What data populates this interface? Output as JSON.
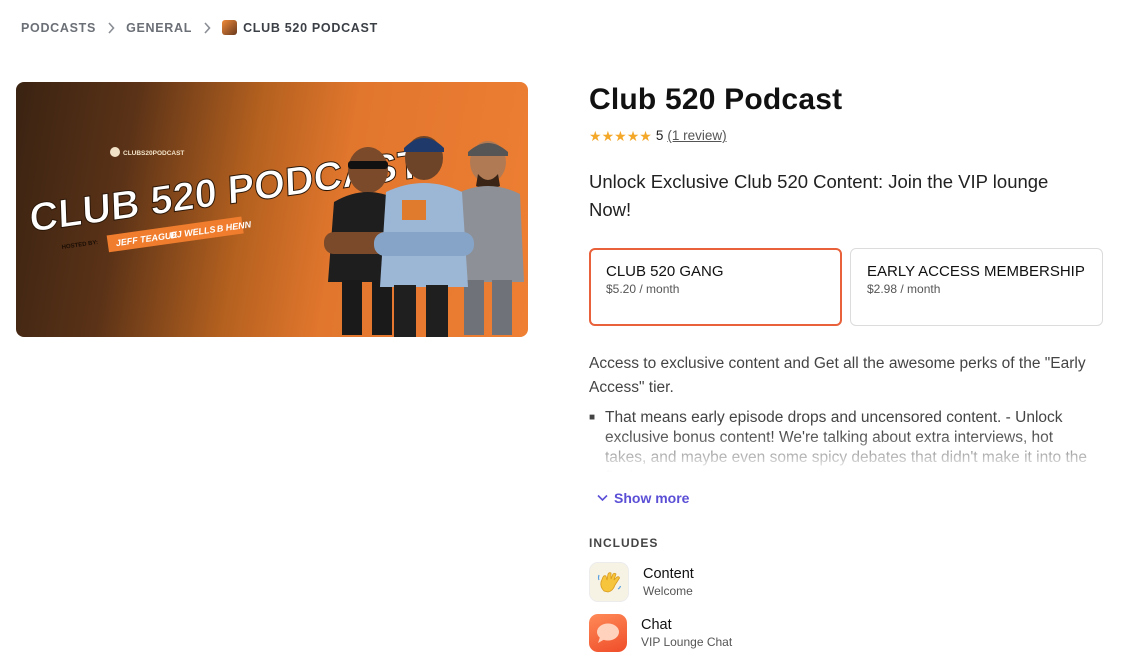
{
  "breadcrumb": {
    "items": [
      "PODCASTS",
      "GENERAL",
      "CLUB 520 PODCAST"
    ]
  },
  "banner": {
    "small_logo_text": "CLUBS20PODCAST",
    "title_line": "CLUB 520 PODCAST",
    "hosted_by": "HOSTED BY:",
    "hosts": [
      "JEFF TEAGUE",
      "DJ WELLS",
      "B HENN"
    ]
  },
  "product": {
    "title": "Club 520 Podcast",
    "rating_value": "5",
    "rating_stars": 5,
    "review_link": "(1 review)",
    "tagline": "Unlock Exclusive Club 520 Content: Join the VIP lounge Now!"
  },
  "tiers": [
    {
      "name": "CLUB 520 GANG",
      "price": "$5.20 / month"
    },
    {
      "name": "EARLY ACCESS MEMBERSHIP",
      "price": "$2.98 / month"
    }
  ],
  "description": {
    "intro": "Access to exclusive content and Get all the awesome perks of the \"Early Access\" tier.",
    "bullet": "That means early episode drops and uncensored content. - Unlock exclusive bonus content! We're talking about extra interviews, hot takes, and maybe even some spicy debates that didn't make it into the final cut.",
    "show_more": "Show more"
  },
  "includes": {
    "heading": "INCLUDES",
    "items": [
      {
        "name": "Content",
        "sub": "Welcome",
        "icon": "waving-hand-icon"
      },
      {
        "name": "Chat",
        "sub": "VIP Lounge Chat",
        "icon": "chat-bubble-icon"
      }
    ]
  },
  "colors": {
    "accent_border": "#e8613a",
    "link_purple": "#5b4fd6",
    "star": "#f4a82a"
  }
}
